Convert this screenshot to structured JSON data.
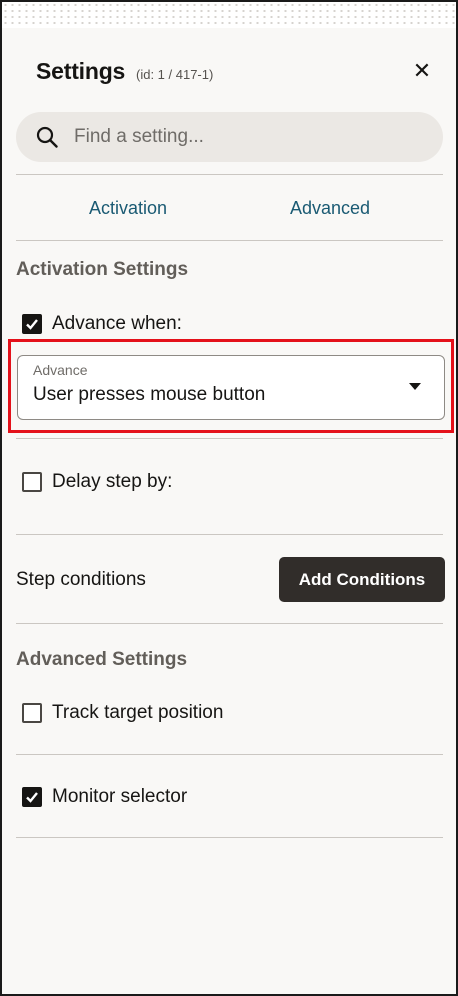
{
  "panel": {
    "title": "Settings",
    "id_text": "(id: 1 / 417-1)",
    "close_glyph": "✕"
  },
  "search": {
    "placeholder": "Find a setting...",
    "value": ""
  },
  "tabs": [
    {
      "label": "Activation"
    },
    {
      "label": "Advanced"
    }
  ],
  "activation": {
    "section_title": "Activation Settings",
    "advance_when": {
      "label": "Advance when:",
      "checked": true
    },
    "advance_select": {
      "label": "Advance",
      "value": "User presses mouse button"
    },
    "delay": {
      "label": "Delay step by:",
      "checked": false
    },
    "step_conditions": {
      "label": "Step conditions",
      "button": "Add Conditions"
    }
  },
  "advanced": {
    "section_title": "Advanced Settings",
    "track_target": {
      "label": "Track target position",
      "checked": false
    },
    "monitor_selector": {
      "label": "Monitor selector",
      "checked": true
    }
  },
  "colors": {
    "accent_link": "#1a5a73",
    "highlight_border": "#e4111a",
    "button_bg": "#312d2a"
  }
}
